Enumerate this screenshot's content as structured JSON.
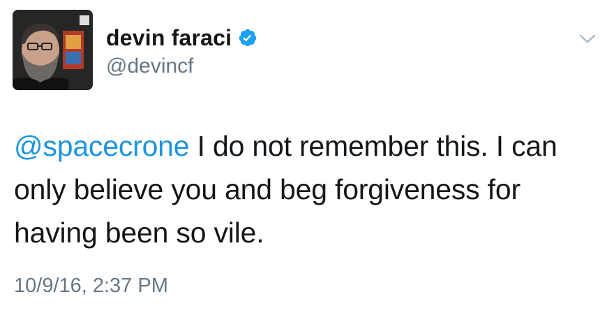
{
  "user": {
    "display_name": "devin faraci",
    "handle": "@devincf",
    "verified": true
  },
  "tweet": {
    "mention": "@spacecrone",
    "body": " I do not remember this. I can only believe you and beg forgiveness for having been so vile.",
    "timestamp": "10/9/16, 2:37 PM"
  },
  "icons": {
    "verified": "verified-badge-icon",
    "menu": "chevron-down-icon"
  },
  "colors": {
    "link": "#1b95e0",
    "secondary_text": "#657786",
    "verified": "#1da1f2",
    "primary_text": "#14171a"
  }
}
